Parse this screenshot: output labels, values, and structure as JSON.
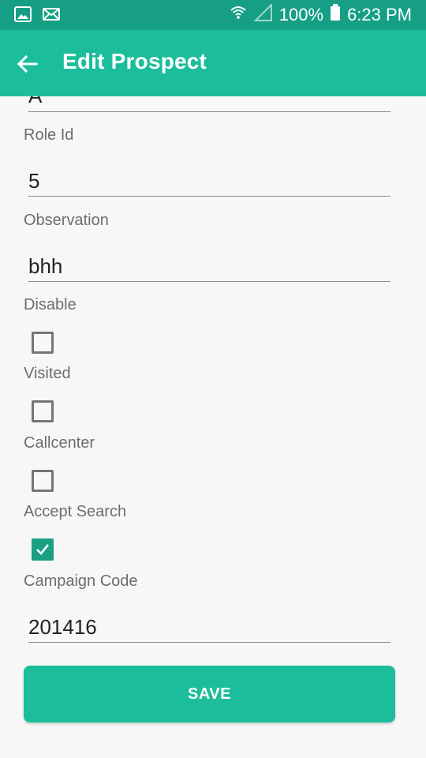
{
  "status_bar": {
    "battery": "100%",
    "time": "6:23 PM",
    "icons": [
      "image-icon",
      "mail-icon",
      "wifi-icon",
      "signal-icon",
      "battery-icon"
    ]
  },
  "app_bar": {
    "title": "Edit Prospect",
    "back_icon": "arrow-left-icon"
  },
  "form": {
    "partial_field_value": "A",
    "role_id": {
      "label": "Role Id",
      "value": "5"
    },
    "observation": {
      "label": "Observation",
      "value": "bhh"
    },
    "disable": {
      "label": "Disable",
      "checked": false
    },
    "visited": {
      "label": "Visited",
      "checked": false
    },
    "callcenter": {
      "label": "Callcenter",
      "checked": false
    },
    "accept_search": {
      "label": "Accept Search",
      "checked": true
    },
    "campaign_code": {
      "label": "Campaign Code",
      "value": "201416"
    },
    "save_label": "SAVE"
  },
  "colors": {
    "status_bar": "#169f85",
    "app_bar": "#1bbd9b",
    "checkbox_checked": "#1a9e84",
    "label_text": "#6d6d6d",
    "background": "#f7f7f7"
  }
}
